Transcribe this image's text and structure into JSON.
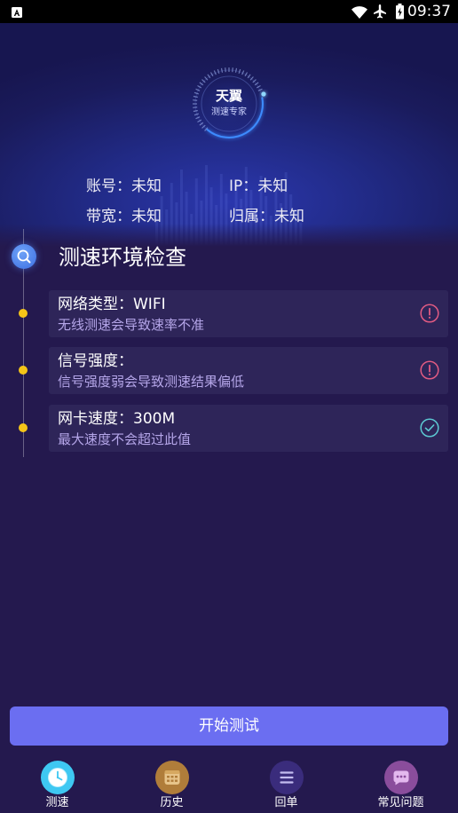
{
  "status_bar": {
    "time": "09:37",
    "left_icon": "a-letter-icon",
    "right_icons": [
      "wifi-icon",
      "airplane-icon",
      "battery-charging-icon"
    ]
  },
  "logo": {
    "icon": "speed-gauge-icon",
    "title": "天翼",
    "subtitle": "测速专家"
  },
  "info": {
    "account": {
      "label": "账号：",
      "value": "未知"
    },
    "ip": {
      "label": "IP：",
      "value": "未知"
    },
    "bandwidth": {
      "label": "带宽：",
      "value": "未知"
    },
    "region": {
      "label": "归属：",
      "value": "未知"
    }
  },
  "section": {
    "icon": "search-icon",
    "title": "测速环境检查"
  },
  "checks": [
    {
      "title": "网络类型：WIFI",
      "description": "无线测速会导致速率不准",
      "status_icon": "exclamation-circle-icon",
      "status_color": "#e25b82"
    },
    {
      "title": "信号强度：",
      "description": "信号强度弱会导致测速结果偏低",
      "status_icon": "exclamation-circle-icon",
      "status_color": "#e25b82"
    },
    {
      "title": "网卡速度：300M",
      "description": "最大速度不会超过此值",
      "status_icon": "check-circle-icon",
      "status_color": "#5cc9d3"
    }
  ],
  "start_button": {
    "label": "开始测试"
  },
  "bottom_nav": {
    "items": [
      {
        "label": "测速",
        "icon": "clock-icon",
        "color": "#3ec8f2"
      },
      {
        "label": "历史",
        "icon": "calendar-icon",
        "color": "#b07d3a"
      },
      {
        "label": "回单",
        "icon": "list-icon",
        "color": "#3a2c7c"
      },
      {
        "label": "常见问题",
        "icon": "chat-icon",
        "color": "#8a4d9c"
      }
    ]
  },
  "colors": {
    "background": "#24194e",
    "card": "#2e2559",
    "accent": "#6b6ef1",
    "timeline_dot": "#f5c518"
  }
}
